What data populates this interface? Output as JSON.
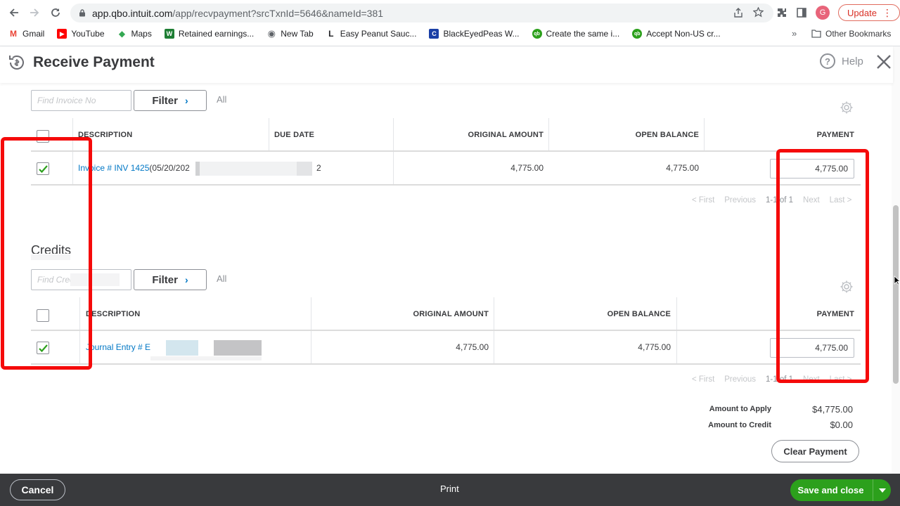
{
  "browser": {
    "url_host": "app.qbo.intuit.com",
    "url_path": "/app/recvpayment?srcTxnId=5646&nameId=381",
    "profile_initial": "G",
    "update_label": "Update",
    "bookmarks": [
      {
        "label": "Gmail",
        "icon": "gmail-icon",
        "color": "#ea4335"
      },
      {
        "label": "YouTube",
        "icon": "youtube-icon",
        "color": "#ff0000"
      },
      {
        "label": "Maps",
        "icon": "maps-icon",
        "color": "#34a853"
      },
      {
        "label": "Retained earnings...",
        "icon": "w-icon",
        "color": "#1e7e34"
      },
      {
        "label": "New Tab",
        "icon": "globe-icon",
        "color": "#5f6368"
      },
      {
        "label": "Easy Peanut Sauc...",
        "icon": "l-icon",
        "color": "#202124"
      },
      {
        "label": "BlackEyedPeas W...",
        "icon": "c-icon",
        "color": "#1a3fa6"
      },
      {
        "label": "Create the same i...",
        "icon": "qb-icon",
        "color": "#2ca01c"
      },
      {
        "label": "Accept Non-US cr...",
        "icon": "qb-icon",
        "color": "#2ca01c"
      }
    ],
    "bookmarks_more": "»",
    "other_bookmarks": "Other Bookmarks"
  },
  "header": {
    "title": "Receive Payment",
    "help_label": "Help"
  },
  "invoices": {
    "find_placeholder": "Find Invoice No",
    "filter_label": "Filter",
    "all_label": "All",
    "columns": {
      "description": "DESCRIPTION",
      "due_date": "DUE DATE",
      "original_amount": "ORIGINAL AMOUNT",
      "open_balance": "OPEN BALANCE",
      "payment": "PAYMENT"
    },
    "rows": [
      {
        "checked": true,
        "description_link": "Invoice # INV 1425",
        "description_rest": " (05/20/202",
        "due_date_tail": "2",
        "original_amount": "4,775.00",
        "open_balance": "4,775.00",
        "payment": "4,775.00"
      }
    ],
    "pager": {
      "first": "< First",
      "previous": "Previous",
      "range": "1-1 of 1",
      "next": "Next",
      "last": "Last >"
    }
  },
  "credits": {
    "section_title": "Credits",
    "find_placeholder": "Find Credit Memo No",
    "filter_label": "Filter",
    "all_label": "All",
    "columns": {
      "description": "DESCRIPTION",
      "original_amount": "ORIGINAL AMOUNT",
      "open_balance": "OPEN BALANCE",
      "payment": "PAYMENT"
    },
    "rows": [
      {
        "checked": true,
        "description_link": "Journal Entry # E",
        "original_amount": "4,775.00",
        "open_balance": "4,775.00",
        "payment": "4,775.00"
      }
    ],
    "pager": {
      "first": "< First",
      "previous": "Previous",
      "range": "1-1 of 1",
      "next": "Next",
      "last": "Last >"
    }
  },
  "totals": {
    "amount_to_apply_label": "Amount to Apply",
    "amount_to_apply": "$4,775.00",
    "amount_to_credit_label": "Amount to Credit",
    "amount_to_credit": "$0.00",
    "clear_label": "Clear Payment"
  },
  "footer": {
    "cancel_label": "Cancel",
    "print_label": "Print",
    "save_label": "Save and close"
  },
  "colors": {
    "accent_link": "#0077c5",
    "save_green": "#2ca01c",
    "footer_bg": "#393a3d",
    "annotation_red": "#f50a0a"
  }
}
